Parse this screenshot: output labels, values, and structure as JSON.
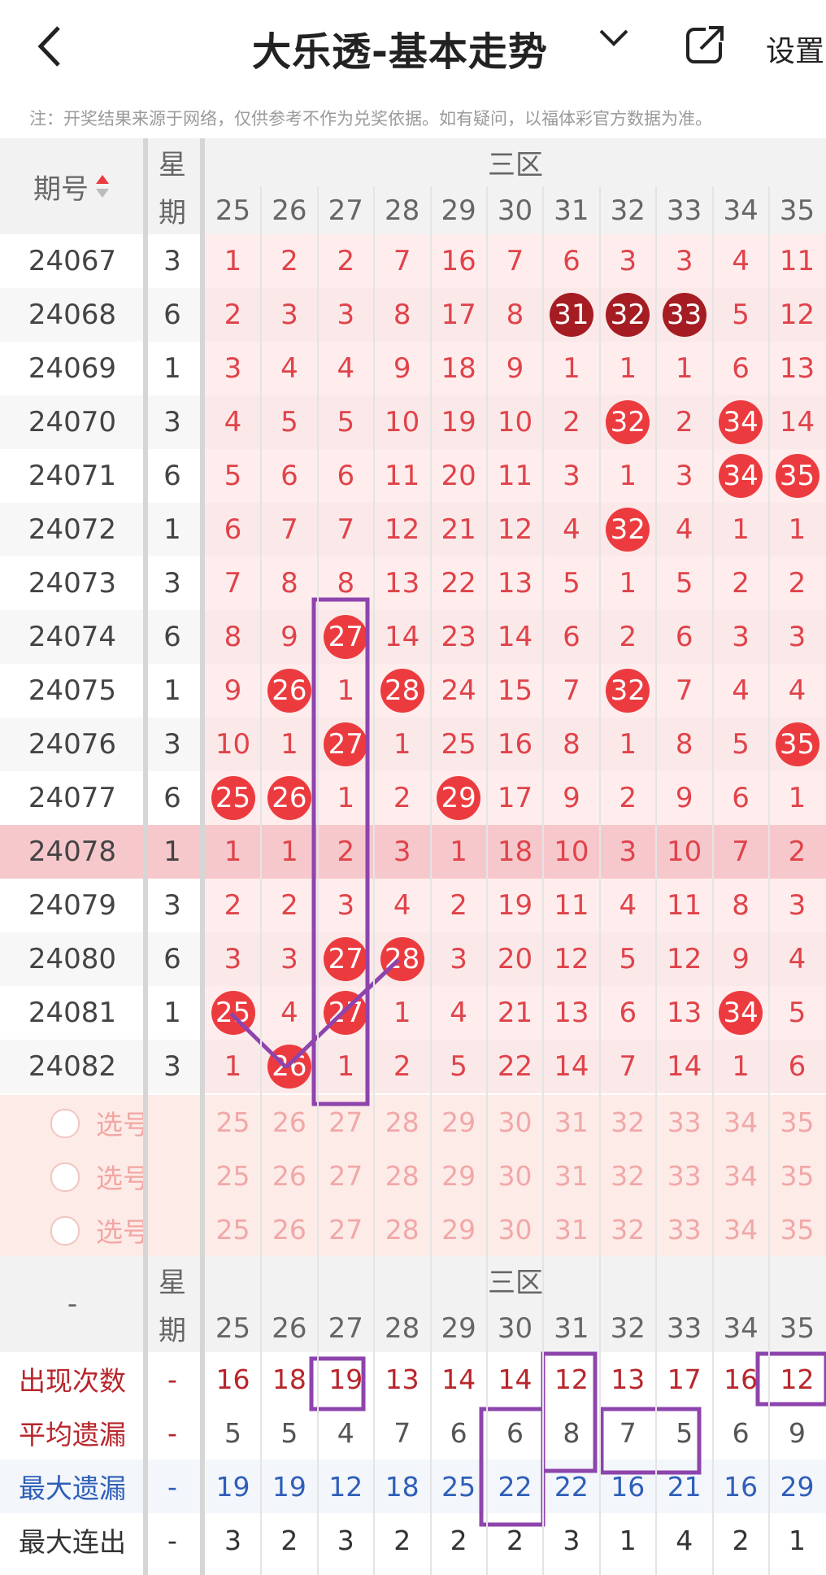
{
  "header": {
    "back_icon": "chevron-left-icon",
    "title": "大乐透-基本走势",
    "title_dropdown_icon": "chevron-down-icon",
    "share_icon": "share-icon",
    "settings_label": "设置"
  },
  "notice": "注：开奖结果来源于网络，仅供参考不作为兑奖依据。如有疑问，以福体彩官方数据为准。",
  "table_header": {
    "issue_label": "期号",
    "sort_icon": "sort-icon",
    "week_top": "星",
    "week_bottom": "期",
    "zone_label": "三区",
    "columns": [
      "25",
      "26",
      "27",
      "28",
      "29",
      "30",
      "31",
      "32",
      "33",
      "34",
      "35"
    ]
  },
  "rows": [
    {
      "issue": "24067",
      "week": "3",
      "values": [
        "1",
        "2",
        "2",
        "7",
        "16",
        "7",
        "6",
        "3",
        "3",
        "4",
        "11"
      ],
      "balls": []
    },
    {
      "issue": "24068",
      "week": "6",
      "values": [
        "2",
        "3",
        "3",
        "8",
        "17",
        "8",
        "31",
        "32",
        "33",
        "5",
        "12"
      ],
      "balls": [
        6,
        7,
        8
      ],
      "dark": true
    },
    {
      "issue": "24069",
      "week": "1",
      "values": [
        "3",
        "4",
        "4",
        "9",
        "18",
        "9",
        "1",
        "1",
        "1",
        "6",
        "13"
      ],
      "balls": []
    },
    {
      "issue": "24070",
      "week": "3",
      "values": [
        "4",
        "5",
        "5",
        "10",
        "19",
        "10",
        "2",
        "32",
        "2",
        "34",
        "14"
      ],
      "balls": [
        7,
        9
      ]
    },
    {
      "issue": "24071",
      "week": "6",
      "values": [
        "5",
        "6",
        "6",
        "11",
        "20",
        "11",
        "3",
        "1",
        "3",
        "34",
        "35"
      ],
      "balls": [
        9,
        10
      ]
    },
    {
      "issue": "24072",
      "week": "1",
      "values": [
        "6",
        "7",
        "7",
        "12",
        "21",
        "12",
        "4",
        "32",
        "4",
        "1",
        "1"
      ],
      "balls": [
        7
      ]
    },
    {
      "issue": "24073",
      "week": "3",
      "values": [
        "7",
        "8",
        "8",
        "13",
        "22",
        "13",
        "5",
        "1",
        "5",
        "2",
        "2"
      ],
      "balls": []
    },
    {
      "issue": "24074",
      "week": "6",
      "values": [
        "8",
        "9",
        "27",
        "14",
        "23",
        "14",
        "6",
        "2",
        "6",
        "3",
        "3"
      ],
      "balls": [
        2
      ]
    },
    {
      "issue": "24075",
      "week": "1",
      "values": [
        "9",
        "26",
        "1",
        "28",
        "24",
        "15",
        "7",
        "32",
        "7",
        "4",
        "4"
      ],
      "balls": [
        1,
        3,
        7
      ]
    },
    {
      "issue": "24076",
      "week": "3",
      "values": [
        "10",
        "1",
        "27",
        "1",
        "25",
        "16",
        "8",
        "1",
        "8",
        "5",
        "35"
      ],
      "balls": [
        2,
        10
      ]
    },
    {
      "issue": "24077",
      "week": "6",
      "values": [
        "25",
        "26",
        "1",
        "2",
        "29",
        "17",
        "9",
        "2",
        "9",
        "6",
        "1"
      ],
      "balls": [
        0,
        1,
        4
      ]
    },
    {
      "issue": "24078",
      "week": "1",
      "values": [
        "1",
        "1",
        "2",
        "3",
        "1",
        "18",
        "10",
        "3",
        "10",
        "7",
        "2"
      ],
      "balls": [],
      "highlight": true
    },
    {
      "issue": "24079",
      "week": "3",
      "values": [
        "2",
        "2",
        "3",
        "4",
        "2",
        "19",
        "11",
        "4",
        "11",
        "8",
        "3"
      ],
      "balls": []
    },
    {
      "issue": "24080",
      "week": "6",
      "values": [
        "3",
        "3",
        "27",
        "28",
        "3",
        "20",
        "12",
        "5",
        "12",
        "9",
        "4"
      ],
      "balls": [
        2,
        3
      ]
    },
    {
      "issue": "24081",
      "week": "1",
      "values": [
        "25",
        "4",
        "27",
        "1",
        "4",
        "21",
        "13",
        "6",
        "13",
        "34",
        "5"
      ],
      "balls": [
        0,
        2,
        9
      ]
    },
    {
      "issue": "24082",
      "week": "3",
      "values": [
        "1",
        "26",
        "1",
        "2",
        "5",
        "22",
        "14",
        "7",
        "14",
        "1",
        "6"
      ],
      "balls": [
        1
      ]
    }
  ],
  "pick_rows": [
    {
      "label": "选号",
      "values": [
        "25",
        "26",
        "27",
        "28",
        "29",
        "30",
        "31",
        "32",
        "33",
        "34",
        "35"
      ]
    },
    {
      "label": "选号",
      "values": [
        "25",
        "26",
        "27",
        "28",
        "29",
        "30",
        "31",
        "32",
        "33",
        "34",
        "35"
      ]
    },
    {
      "label": "选号",
      "values": [
        "25",
        "26",
        "27",
        "28",
        "29",
        "30",
        "31",
        "32",
        "33",
        "34",
        "35"
      ]
    }
  ],
  "stats_header": {
    "dash": "-",
    "week_top": "星",
    "week_bottom": "期",
    "zone_label": "三区",
    "columns": [
      "25",
      "26",
      "27",
      "28",
      "29",
      "30",
      "31",
      "32",
      "33",
      "34",
      "35"
    ]
  },
  "stats": [
    {
      "label": "出现次数",
      "color": "#b8262c",
      "week": "-",
      "values": [
        "16",
        "18",
        "19",
        "13",
        "14",
        "14",
        "12",
        "13",
        "17",
        "16",
        "12"
      ],
      "value_color": "#b8262c"
    },
    {
      "label": "平均遗漏",
      "color": "#b8262c",
      "week": "-",
      "values": [
        "5",
        "5",
        "4",
        "7",
        "6",
        "6",
        "8",
        "7",
        "5",
        "6",
        "9"
      ],
      "value_color": "#555555"
    },
    {
      "label": "最大遗漏",
      "color": "#2f5fb8",
      "week": "-",
      "values": [
        "19",
        "19",
        "12",
        "18",
        "25",
        "22",
        "22",
        "16",
        "21",
        "16",
        "29"
      ],
      "value_color": "#2f5fb8"
    },
    {
      "label": "最大连出",
      "color": "#333333",
      "week": "-",
      "values": [
        "3",
        "2",
        "3",
        "2",
        "2",
        "2",
        "3",
        "1",
        "4",
        "2",
        "1"
      ],
      "value_color": "#333333"
    }
  ],
  "colors": {
    "accent": "#ec3b3f",
    "dark_ball": "#a51c23",
    "annotation": "#8e44ad"
  }
}
